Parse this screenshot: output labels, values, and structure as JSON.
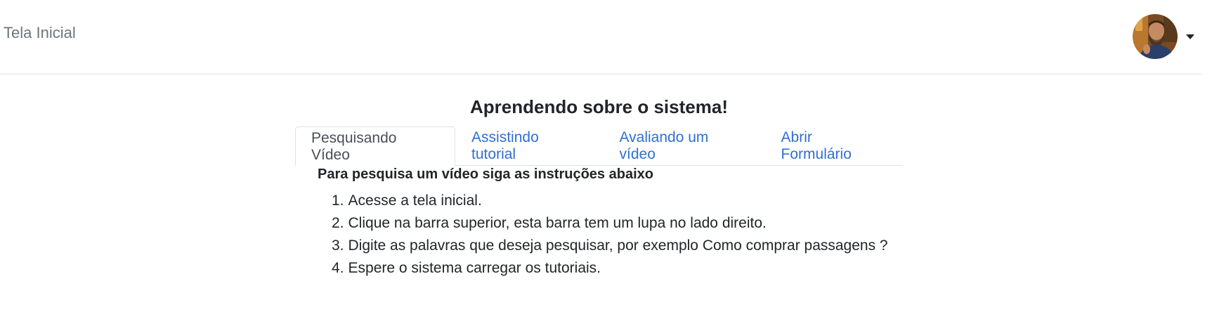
{
  "navbar": {
    "brand_label": "Tela Inicial",
    "avatar_icon": "user-avatar",
    "caret_icon": "caret-down-icon"
  },
  "main": {
    "title": "Aprendendo sobre o sistema!",
    "tabs": [
      {
        "label": "Pesquisando Vídeo",
        "active": true
      },
      {
        "label": "Assistindo tutorial",
        "active": false
      },
      {
        "label": "Avaliando um vídeo",
        "active": false
      },
      {
        "label": "Abrir Formulário",
        "active": false
      }
    ],
    "panel": {
      "heading": "Para pesquisa um vídeo siga as instruções abaixo",
      "steps": [
        {
          "num": "1.",
          "text": "Acesse a tela inicial."
        },
        {
          "num": "2.",
          "text": "Clique na barra superior, esta barra tem um lupa no lado direito."
        },
        {
          "num": "3.",
          "text": "Digite as palavras que deseja pesquisar, por exemplo Como comprar passagens ?"
        },
        {
          "num": "4.",
          "text": "Espere o sistema carregar os tutoriais."
        }
      ]
    }
  },
  "colors": {
    "link": "#2f6fd4",
    "active_tab_text": "#495057",
    "border": "#dee2e6",
    "brand_text": "#6c757d"
  }
}
